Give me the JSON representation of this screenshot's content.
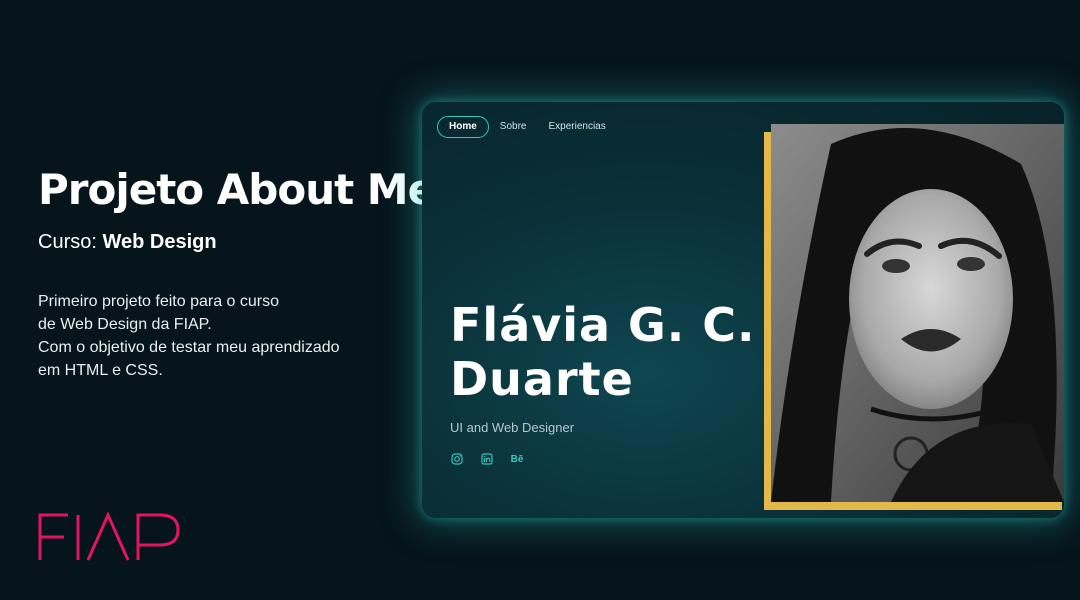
{
  "left": {
    "title": "Projeto About Me",
    "course_prefix": "Curso:",
    "course_name": "Web Design",
    "description_lines": [
      "Primeiro projeto feito para o curso",
      "de Web Design da FIAP.",
      "Com o objetivo de testar meu aprendizado",
      "em HTML e  CSS."
    ],
    "logo_text": "FIAP"
  },
  "mockup": {
    "nav": [
      "Home",
      "Sobre",
      "Experiencias"
    ],
    "name_line1": "Flávia G. C.",
    "name_line2": "Duarte",
    "role": "UI and Web Designer",
    "social_icons": [
      "instagram-icon",
      "linkedin-icon",
      "behance-icon"
    ],
    "behance_label": "Bē"
  },
  "colors": {
    "background": "#06141b",
    "accent_teal": "#38c6bf",
    "frame_gold": "#e2b84a",
    "fiap_pink": "#e3155f"
  }
}
